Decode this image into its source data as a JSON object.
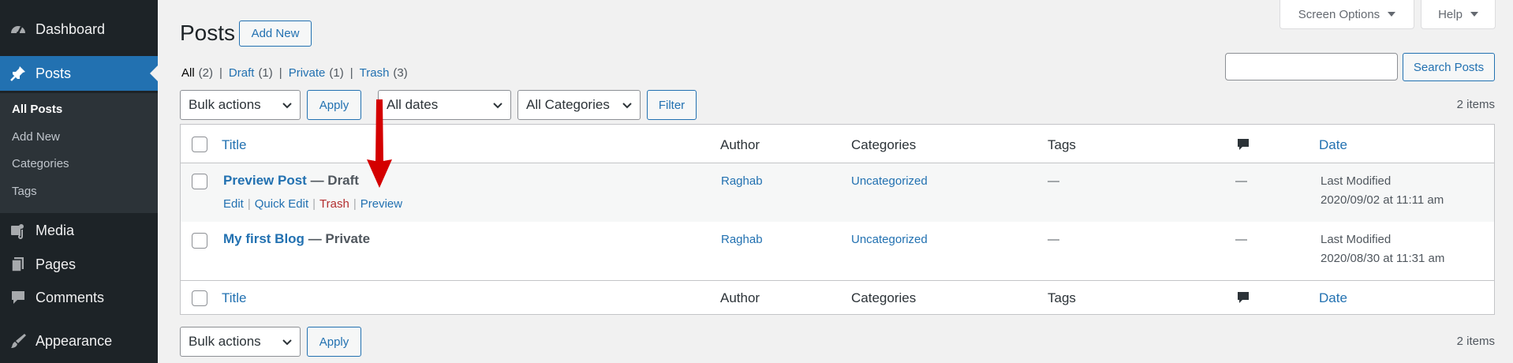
{
  "sidebar": {
    "items": [
      {
        "label": "Dashboard",
        "icon": "dashboard-icon"
      },
      {
        "label": "Posts",
        "icon": "pin-icon",
        "current": true
      },
      {
        "label": "Media",
        "icon": "media-icon"
      },
      {
        "label": "Pages",
        "icon": "pages-icon"
      },
      {
        "label": "Comments",
        "icon": "comments-icon"
      },
      {
        "label": "Appearance",
        "icon": "brush-icon"
      }
    ],
    "submenu": [
      "All Posts",
      "Add New",
      "Categories",
      "Tags"
    ]
  },
  "screen_options": {
    "label": "Screen Options"
  },
  "help": {
    "label": "Help"
  },
  "header": {
    "title": "Posts",
    "add_new": "Add New"
  },
  "filters": {
    "all": {
      "label": "All",
      "count": "(2)"
    },
    "draft": {
      "label": "Draft",
      "count": "(1)"
    },
    "private": {
      "label": "Private",
      "count": "(1)"
    },
    "trash": {
      "label": "Trash",
      "count": "(3)"
    },
    "separator": "|"
  },
  "search": {
    "value": "",
    "button": "Search Posts"
  },
  "bulk": {
    "select": "Bulk actions",
    "apply": "Apply"
  },
  "dates": {
    "select": "All dates"
  },
  "categories_filter": {
    "select": "All Categories"
  },
  "filter_button": "Filter",
  "items_count": "2 items",
  "columns": {
    "title": "Title",
    "author": "Author",
    "categories": "Categories",
    "tags": "Tags",
    "comments_icon": "comment-bubble-icon",
    "date": "Date"
  },
  "rows": [
    {
      "title": "Preview Post",
      "state": "— Draft",
      "author": "Raghab",
      "categories": "Uncategorized",
      "tags": "—",
      "comments": "—",
      "date_label": "Last Modified",
      "date_value": "2020/09/02 at 11:11 am",
      "actions": {
        "edit": "Edit",
        "quick_edit": "Quick Edit",
        "trash": "Trash",
        "preview": "Preview",
        "sep": "|"
      }
    },
    {
      "title": "My first Blog",
      "state": "— Private",
      "author": "Raghab",
      "categories": "Uncategorized",
      "tags": "—",
      "comments": "—",
      "date_label": "Last Modified",
      "date_value": "2020/08/30 at 11:31 am"
    }
  ],
  "annotation": {
    "arrow_color": "#d40000"
  },
  "colors": {
    "sidebar_bg": "#1d2327",
    "accent": "#2271b1",
    "danger": "#b32d2e"
  }
}
